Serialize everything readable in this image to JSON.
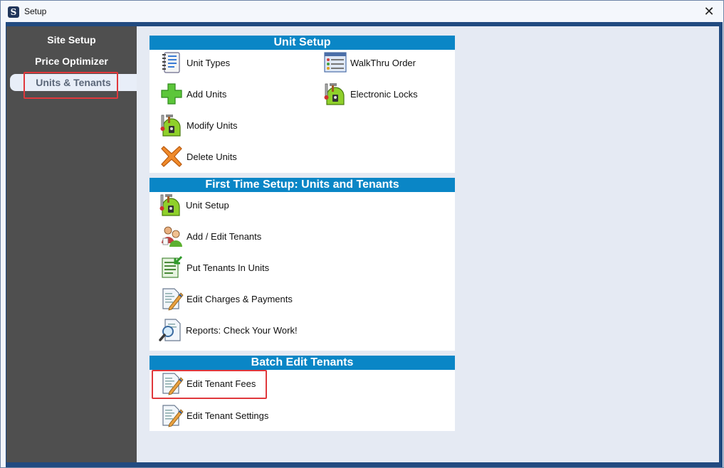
{
  "window": {
    "title": "Setup"
  },
  "sidebar": {
    "items": [
      {
        "label": "Site Setup"
      },
      {
        "label": "Price Optimizer"
      },
      {
        "label": "Units & Tenants"
      }
    ]
  },
  "unit_setup": {
    "header": "Unit Setup",
    "unit_types": "Unit Types",
    "walkthru_order": "WalkThru Order",
    "add_units": "Add Units",
    "electronic_locks": "Electronic Locks",
    "modify_units": "Modify Units",
    "delete_units": "Delete Units"
  },
  "first_time_setup": {
    "header": "First Time Setup:  Units and Tenants",
    "unit_setup": "Unit Setup",
    "add_edit_tenants": "Add / Edit Tenants",
    "put_tenants_in_units": "Put Tenants In Units",
    "edit_charges_payments": "Edit Charges & Payments",
    "reports": "Reports:   Check Your Work!"
  },
  "batch_edit": {
    "header": "Batch Edit Tenants",
    "edit_tenant_fees": "Edit Tenant Fees",
    "edit_tenant_settings": "Edit Tenant Settings"
  },
  "colors": {
    "header_blue": "#0a86c6",
    "sidebar_gray": "#4f4f4f",
    "highlight_red": "#e0383c"
  },
  "icons": {
    "unit_types": "notebook-icon",
    "walkthru_order": "grid-list-icon",
    "add_units": "green-plus-icon",
    "electronic_locks": "tools-lock-icon",
    "modify_units": "tools-lock-icon",
    "delete_units": "orange-x-icon",
    "add_edit_tenants": "people-icon",
    "put_tenants_in_units": "list-arrow-icon",
    "edit_document": "document-pencil-icon",
    "reports": "magnifier-document-icon"
  }
}
